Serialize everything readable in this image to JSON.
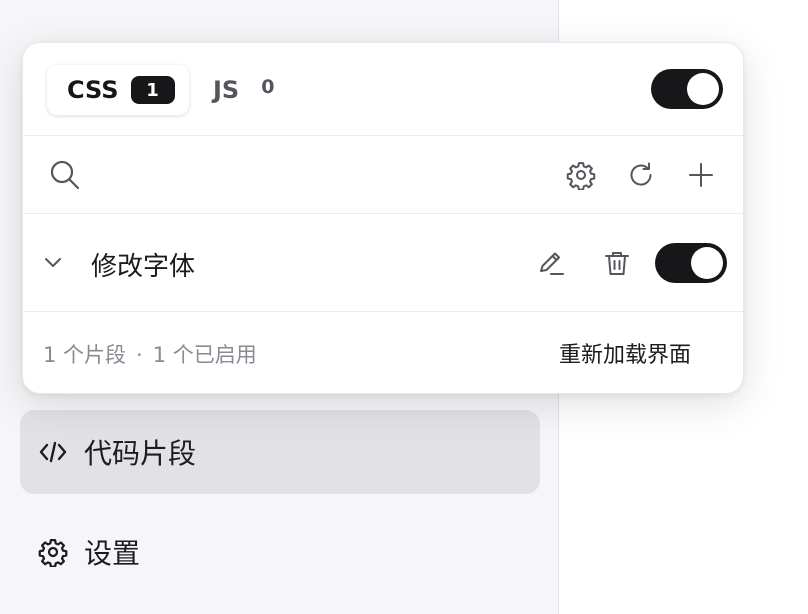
{
  "popover": {
    "tabs": [
      {
        "label": "CSS",
        "count": "1"
      },
      {
        "label": "JS",
        "count": "0"
      }
    ],
    "snippet": {
      "name": "修改字体"
    },
    "footer": {
      "snippet_count": "1 个片段",
      "separator": "·",
      "enabled_count": "1 个已启用",
      "reload_label": "重新加载界面"
    }
  },
  "sidebar": {
    "items": [
      {
        "label": "代码片段",
        "icon": "code-icon",
        "active": true
      },
      {
        "label": "设置",
        "icon": "gear-icon",
        "active": false
      }
    ]
  },
  "icons": [
    "search-icon",
    "gear-icon",
    "refresh-icon",
    "plus-icon",
    "chevron-down-icon",
    "pencil-icon",
    "trash-icon"
  ],
  "colors": {
    "toggle_on": "#17171a",
    "sidebar_bg": "#f6f6f8",
    "active_item_bg": "#e2e2e6",
    "muted_text": "#8a8a92"
  }
}
